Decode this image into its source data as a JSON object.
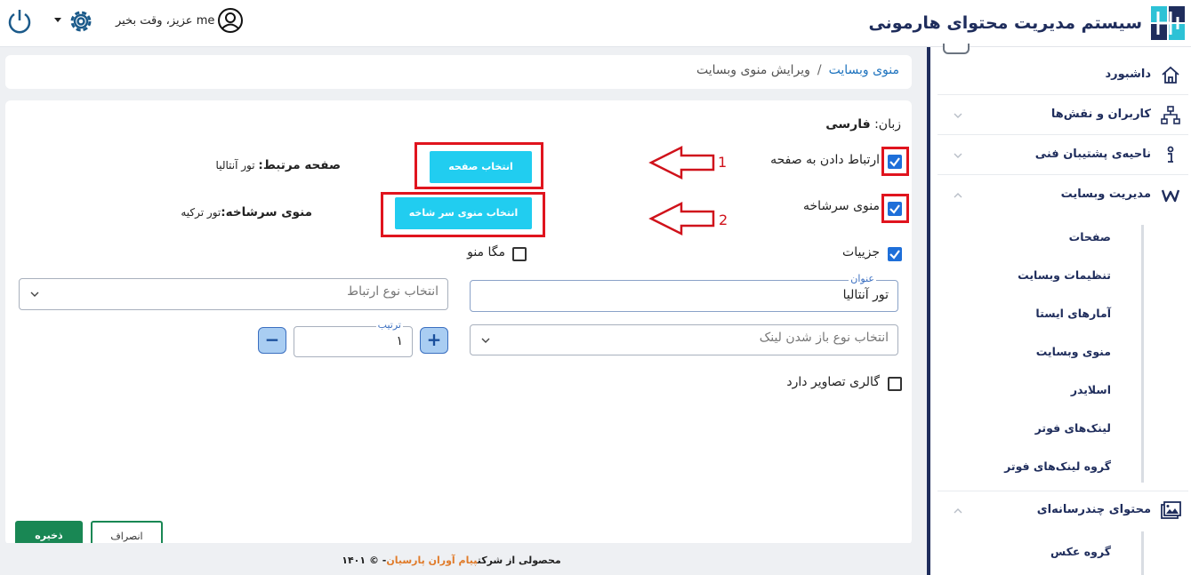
{
  "header": {
    "app_title": "سیستم مدیریت محتوای هارمونی",
    "user_greeting": "me عزیز، وقت بخیر",
    "icons": [
      "logo-icon",
      "user-icon",
      "gear-icon",
      "power-icon"
    ]
  },
  "sidebar": {
    "items": [
      {
        "label": "داشبورد",
        "icon": "home-icon"
      },
      {
        "label": "کاربران و نقش‌ها",
        "icon": "sitemap-icon"
      },
      {
        "label": "ناحیه‌ی پشتیبان فنی",
        "icon": "info-icon"
      },
      {
        "label": "مدیریت وبسایت",
        "icon": "w-icon"
      }
    ],
    "website_sub": [
      "صفحات",
      "تنظیمات وبسایت",
      "آمارهای ایستا",
      "منوی وبسایت",
      "اسلایدر",
      "لینک‌های فوتر",
      "گروه لینک‌های فوتر"
    ],
    "media_item": {
      "label": "محتوای چندرسانه‌ای",
      "icon": "image-icon"
    },
    "media_sub": [
      "گروه عکس"
    ]
  },
  "breadcrumb": {
    "link": "منوی وبسایت",
    "separator": "/",
    "current": "ویرایش منوی وبسایت"
  },
  "form": {
    "language_label": "زبان:",
    "language_value": "فارسی",
    "link_to_page": {
      "label": "ارتباط دادن به صفحه",
      "checked": true
    },
    "select_page_button": "انتخاب صفحه",
    "related_page_label": "صفحه مرتبط:",
    "related_page_value": "تور آنتالیا",
    "parent_menu": {
      "label": "منوی سرشاخه",
      "checked": true
    },
    "select_parent_button": "انتخاب منوی سر شاخه",
    "parent_menu_label": "منوی سرشاخه:",
    "parent_menu_value": "تور ترکیه",
    "details": {
      "label": "جزییات",
      "checked": true
    },
    "mega_menu": {
      "label": "مگا منو",
      "checked": false
    },
    "title_legend": "عنوان",
    "title_value": "تور آنتالیا",
    "link_type_placeholder": "انتخاب نوع ارتباط",
    "open_type_placeholder": "انتخاب نوع باز شدن لینک",
    "order_legend": "ترتیب",
    "order_value": "۱",
    "plus": "+",
    "minus": "−",
    "gallery": {
      "label": "گالری تصاویر دارد",
      "checked": false
    },
    "save_button": "ذخیره",
    "cancel_button": "انصراف"
  },
  "annotations": {
    "one": "1",
    "two": "2",
    "arrow_color": "#d0121b"
  },
  "footer": {
    "prefix": "محصولی از شرکت",
    "company": "پیام آوران پارسیان",
    "suffix": "- © ۱۴۰۱"
  },
  "colors": {
    "accent": "#1e6fd9",
    "cyan_button": "#21cdf0",
    "save_green": "#198754",
    "navy": "#1f2d5c",
    "annotation_red": "#e0141e"
  }
}
